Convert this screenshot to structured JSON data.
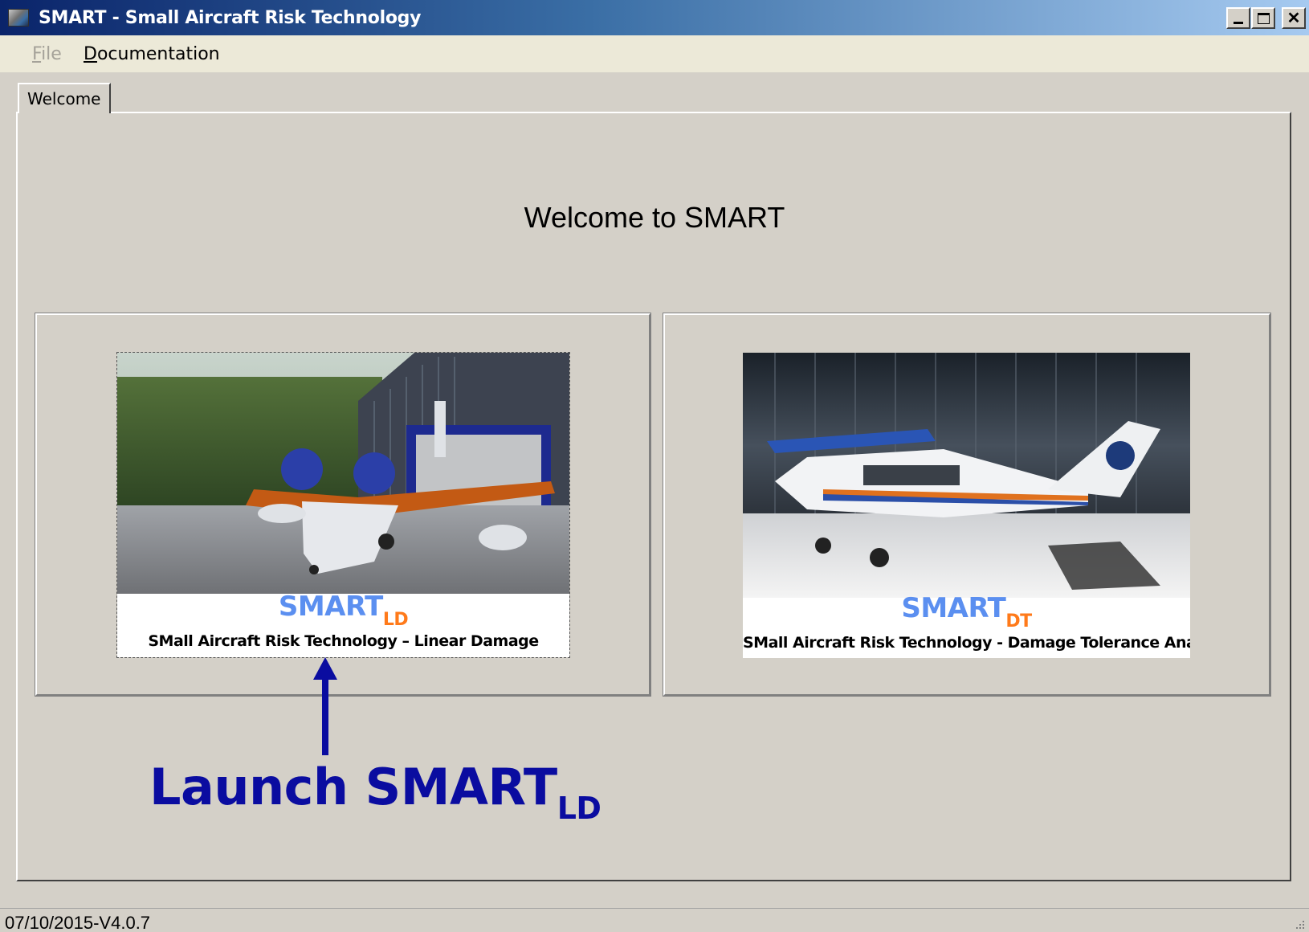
{
  "window": {
    "title": "SMART - Small Aircraft Risk Technology",
    "icon": "app-icon",
    "controls": [
      "minimize",
      "maximize",
      "close"
    ]
  },
  "menu": {
    "file": "File",
    "documentation": "Documentation"
  },
  "tabs": [
    {
      "label": "Welcome",
      "selected": true
    }
  ],
  "welcome": {
    "title": "Welcome to SMART"
  },
  "modules": [
    {
      "name": "SMART",
      "subscript": "LD",
      "caption": "SMall Aircraft Risk Technology – Linear Damage",
      "image": "seaplane-in-front-of-hangar"
    },
    {
      "name": "SMART",
      "subscript": "DT",
      "caption": "SMall Aircraft Risk Technology - Damage Tolerance Analysis",
      "image": "single-engine-plane-in-hangar"
    }
  ],
  "annotation": {
    "text": "Launch SMART",
    "subscript": "LD",
    "color": "#0a0ca0"
  },
  "status": {
    "version": "07/10/2015-V4.0.7"
  },
  "colors": {
    "title_bar": "#0a246a",
    "face": "#d4d0c8",
    "logo_blue": "#5b8ff0",
    "logo_orange": "#ff7a1a"
  }
}
